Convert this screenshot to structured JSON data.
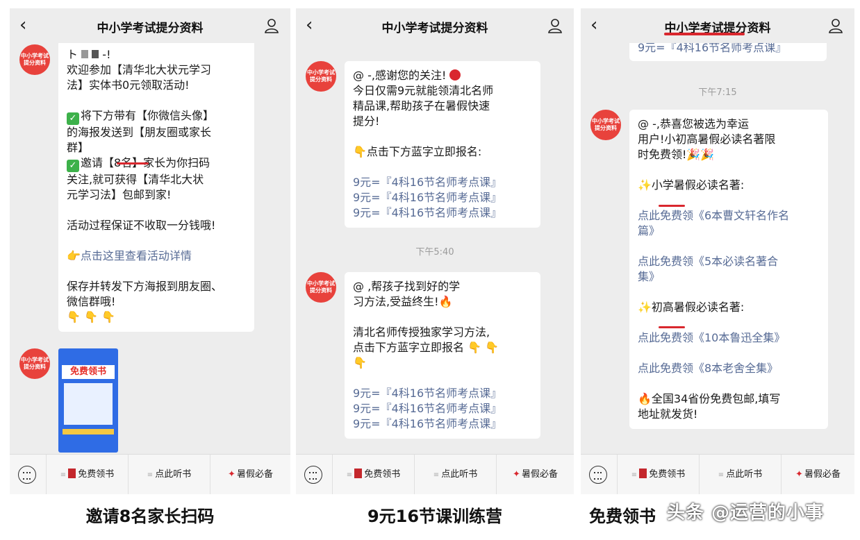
{
  "header": {
    "title": "中小学考试提分资料"
  },
  "avatar": {
    "line1": "中小学考试",
    "line2": "提分资料"
  },
  "menu": {
    "item1": "免费领书",
    "item2": "点此听书",
    "item3": "暑假必备"
  },
  "panel1": {
    "msg": {
      "l1": "ト",
      "l1b": "-!",
      "l2": "欢迎参加【清华北大状元学习",
      "l3": "法】实体书0元领取活动!",
      "l4": "将下方带有【你微信头像】",
      "l5": "的海报发送到【朋友圈或家长",
      "l6": "群】",
      "l7": "邀请【8名】家长为你扫码",
      "l8": "关注,就可获得【清华北大状",
      "l9": "元学习法】包邮到家!",
      "l10": "活动过程保证不收取一分钱哦!",
      "l11": "点击这里查看活动详情",
      "l12": "保存并转发下方海报到朋友圈、",
      "l13": "微信群哦!",
      "l14": "👇 👇 👇"
    },
    "poster_title": "免费领书",
    "caption": "邀请8名家长扫码"
  },
  "panel2": {
    "msg1": {
      "l1": "@      -,感谢您的关注!",
      "l2": "今日仅需9元就能领清北名师",
      "l3": "精品课,帮助孩子在暑假快速",
      "l4": "提分!",
      "l5": "👇点击下方蓝字立即报名:",
      "link": "9元=『4科16节名师考点课』"
    },
    "time": "下午5:40",
    "msg2": {
      "l1": "@        ,帮孩子找到好的学",
      "l2": "习方法,受益终生!🔥",
      "l3": "清北名师传授独家学习方法,",
      "l4": "点击下方蓝字立即报名 👇 👇",
      "l5": "👇",
      "link": "9元=『4科16节名师考点课』"
    },
    "caption": "9元16节课训练营"
  },
  "panel3": {
    "top_link": "9元=『4科16节名师考点课』",
    "time": "下午7:15",
    "msg": {
      "l1": "@      -,恭喜您被选为幸运",
      "l2": "用户!小初高暑假必读名著限",
      "l3": "时免费领!🎉🎉",
      "l4": "✨小学暑假必读名著:",
      "link1a": "点此免费领《6本曹文轩名作名",
      "link1b": "篇》",
      "link2a": "点此免费领《5本必读名著合",
      "link2b": "集》",
      "l5": "✨初高暑假必读名著:",
      "link3": "点此免费领《10本鲁迅全集》",
      "link4": "点此免费领《8本老舍全集》",
      "l6": "🔥全国34省份免费包邮,填写",
      "l7": "地址就发货!"
    },
    "caption": "免费领书"
  },
  "watermark": "头条 @运营的小事",
  "colors": {
    "accent": "#d9272e",
    "link": "#576b95",
    "bg": "#ededed",
    "avatar": "#e8423c"
  }
}
